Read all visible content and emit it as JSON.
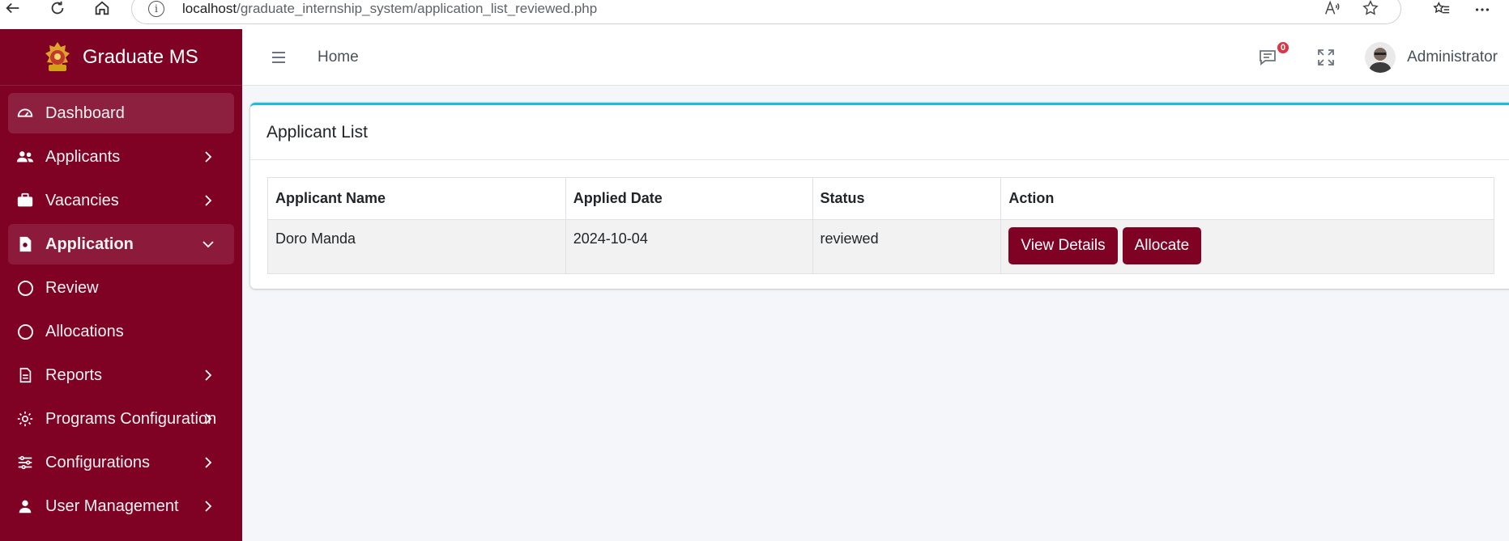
{
  "browser": {
    "url_host": "localhost",
    "url_path": "/graduate_internship_system/application_list_reviewed.php"
  },
  "brand": {
    "name": "Graduate MS"
  },
  "sidebar": {
    "items": [
      {
        "label": "Dashboard",
        "icon": "dashboard-icon"
      },
      {
        "label": "Applicants",
        "icon": "users-icon"
      },
      {
        "label": "Vacancies",
        "icon": "briefcase-icon"
      },
      {
        "label": "Application",
        "icon": "file-icon"
      },
      {
        "label": "Review",
        "icon": "circle-icon"
      },
      {
        "label": "Allocations",
        "icon": "circle-icon"
      },
      {
        "label": "Reports",
        "icon": "document-icon"
      },
      {
        "label": "Programs Configuration",
        "icon": "gear-icon"
      },
      {
        "label": "Configurations",
        "icon": "sliders-icon"
      },
      {
        "label": "User Management",
        "icon": "user-icon"
      }
    ]
  },
  "topbar": {
    "home_label": "Home",
    "message_count": "0",
    "user_name": "Administrator"
  },
  "card": {
    "title": "Applicant List",
    "columns": [
      "Applicant Name",
      "Applied Date",
      "Status",
      "Action"
    ],
    "rows": [
      {
        "name": "Doro Manda",
        "date": "2024-10-04",
        "status": "reviewed"
      }
    ],
    "buttons": {
      "view": "View Details",
      "allocate": "Allocate"
    }
  },
  "colors": {
    "brand": "#7f0225",
    "accent": "#17c0d8"
  }
}
